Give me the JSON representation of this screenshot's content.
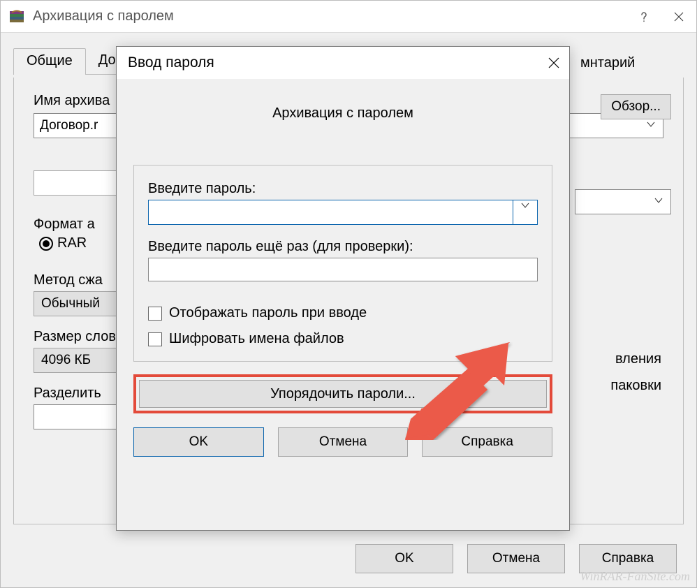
{
  "main": {
    "title": "Архивация с паролем",
    "tabs": {
      "general": "Общие",
      "extra_partial": "До",
      "comment_partial": "мнтарий"
    },
    "archive_name_label": "Имя архива",
    "archive_name_value": "Договор.r",
    "browse_button": "Обзор...",
    "format_label": "Формат а",
    "format_rar": "RAR",
    "method_label": "Метод сжа",
    "method_value": "Обычный",
    "dict_label": "Размер слов",
    "dict_value": "4096 КБ",
    "split_label": "Разделить",
    "right_partial_1": "вления",
    "right_partial_2": "паковки",
    "ok": "OK",
    "cancel": "Отмена",
    "help": "Справка"
  },
  "modal": {
    "title": "Ввод пароля",
    "subtitle": "Архивация с паролем",
    "enter_password": "Введите пароль:",
    "confirm_password": "Введите пароль ещё раз (для проверки):",
    "show_password": "Отображать пароль при вводе",
    "encrypt_names": "Шифровать имена файлов",
    "organize": "Упорядочить пароли...",
    "ok": "OK",
    "cancel": "Отмена",
    "help": "Справка"
  },
  "watermark": "WinRAR-FanSite.com"
}
